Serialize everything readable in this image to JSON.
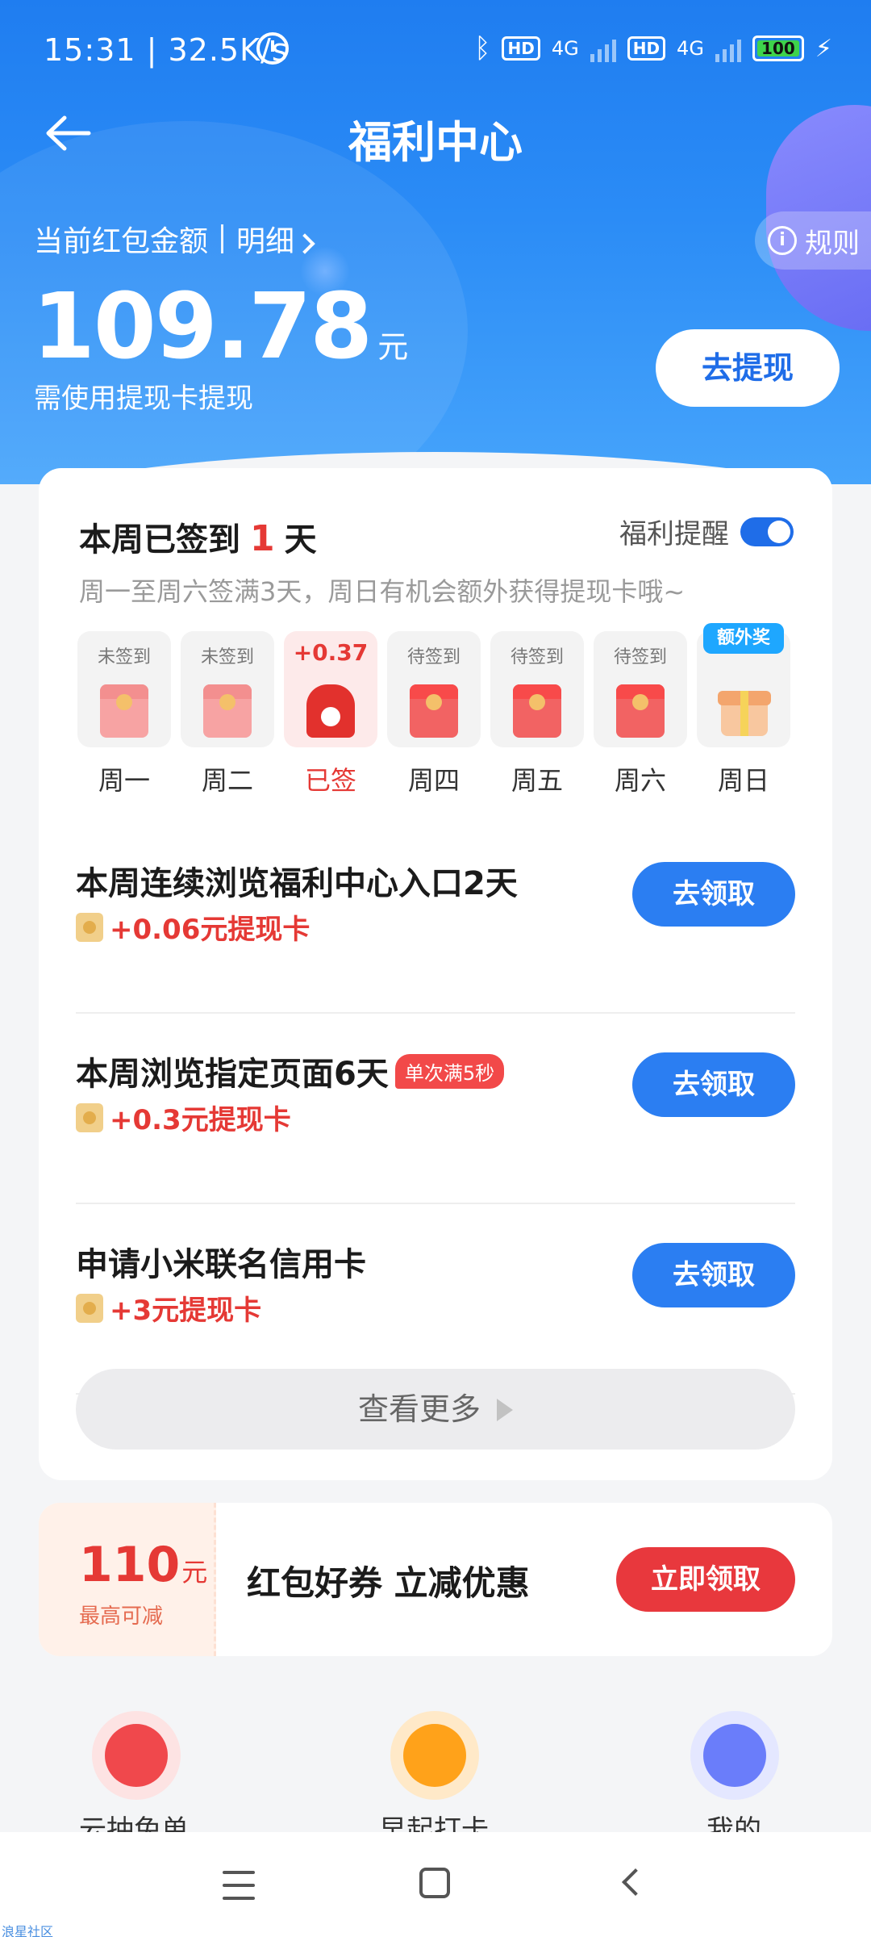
{
  "status_bar": {
    "time": "15:31",
    "speed": "32.5K/s",
    "network_1": "4G",
    "network_2": "4G",
    "hd": "HD",
    "battery": "100"
  },
  "header": {
    "title": "福利中心",
    "balance_label": "当前红包金额",
    "details_link": "明细",
    "rules": "规则",
    "amount": "109.78",
    "amount_unit": "元",
    "amount_note": "需使用提现卡提现",
    "withdraw_button": "去提现"
  },
  "signin": {
    "title_prefix": "本周已签到",
    "days_count": "1",
    "title_suffix": "天",
    "reminder_label": "福利提醒",
    "reminder_on": true,
    "description": "周一至周六签满3天，周日有机会额外获得提现卡哦~",
    "days": [
      {
        "status": "未签到",
        "label": "周一"
      },
      {
        "status": "未签到",
        "label": "周二"
      },
      {
        "status": "+0.37",
        "label": "已签"
      },
      {
        "status": "待签到",
        "label": "周四"
      },
      {
        "status": "待签到",
        "label": "周五"
      },
      {
        "status": "待签到",
        "label": "周六"
      },
      {
        "status": "额外奖",
        "label": "周日"
      }
    ]
  },
  "tasks": [
    {
      "name": "本周连续浏览福利中心入口2天",
      "tag": "",
      "reward": "+0.06元提现卡",
      "button": "去领取"
    },
    {
      "name": "本周浏览指定页面6天",
      "tag": "单次满5秒",
      "reward": "+0.3元提现卡",
      "button": "去领取"
    },
    {
      "name": "申请小米联名信用卡",
      "tag": "",
      "reward": "+3元提现卡",
      "button": "去领取"
    }
  ],
  "more_button": "查看更多",
  "coupon": {
    "amount": "110",
    "unit": "元",
    "subtitle": "最高可减",
    "title": "红包好券 立减优惠",
    "button": "立即领取"
  },
  "shortcuts": [
    {
      "label": "云抽免单",
      "color": "#f0484c"
    },
    {
      "label": "早起打卡",
      "color": "#ffa21a"
    },
    {
      "label": "我的",
      "color": "#6a7dfa"
    }
  ],
  "watermark": "浪星社区"
}
